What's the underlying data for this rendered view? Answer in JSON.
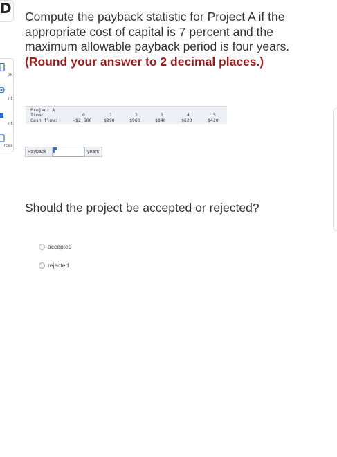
{
  "sidebar": {
    "badge": "D",
    "tools": [
      {
        "icon": "book-icon",
        "label": "ok"
      },
      {
        "icon": "hint-icon",
        "label": "nt"
      },
      {
        "icon": "print-icon",
        "label": "nt"
      },
      {
        "icon": "references-icon",
        "label": "rces"
      }
    ]
  },
  "question": {
    "text": "Compute the payback statistic for Project A if the appropriate cost of capital is 7 percent and the maximum allowable payback period is four years. ",
    "emphasis": "(Round your answer to 2 decimal places.)"
  },
  "project_table": {
    "title": "Project A",
    "time_label": "Time:",
    "cashflow_label": "Cash flow:",
    "times": [
      "0",
      "1",
      "2",
      "3",
      "4",
      "5"
    ],
    "cash_flows": [
      "-$2,600",
      "$990",
      "$960",
      "$840",
      "$620",
      "$420"
    ]
  },
  "payback": {
    "label": "Payback",
    "value": "",
    "unit": "years"
  },
  "question2": {
    "text": "Should the project be accepted or rejected?",
    "options": [
      "accepted",
      "rejected"
    ],
    "selected": null
  }
}
